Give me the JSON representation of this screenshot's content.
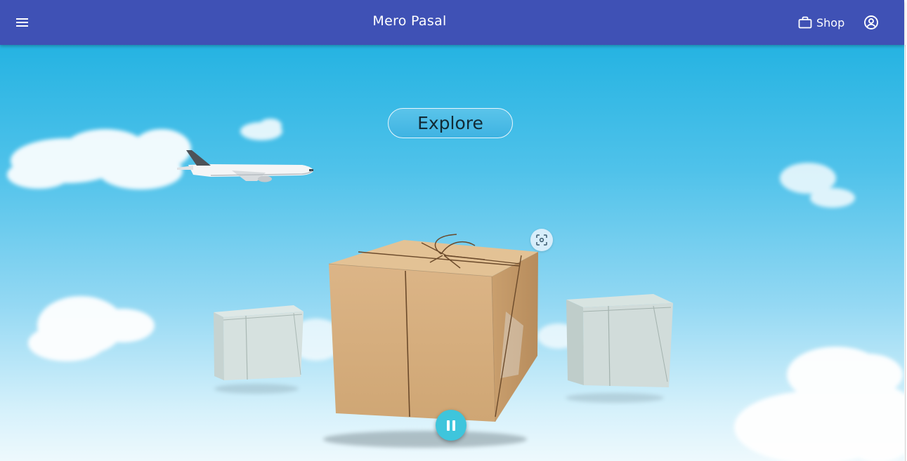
{
  "appbar": {
    "title": "Mero Pasal",
    "menu_icon": "menu-icon",
    "shop_label": "Shop",
    "shop_icon": "shopping-bag-icon",
    "account_icon": "account-circle-icon",
    "background_color": "#3f51b5"
  },
  "hero": {
    "explore_label": "Explore",
    "ar_view_icon": "view-in-ar-icon",
    "pause_icon": "pause-icon",
    "accent_color": "#3ec5dc"
  }
}
